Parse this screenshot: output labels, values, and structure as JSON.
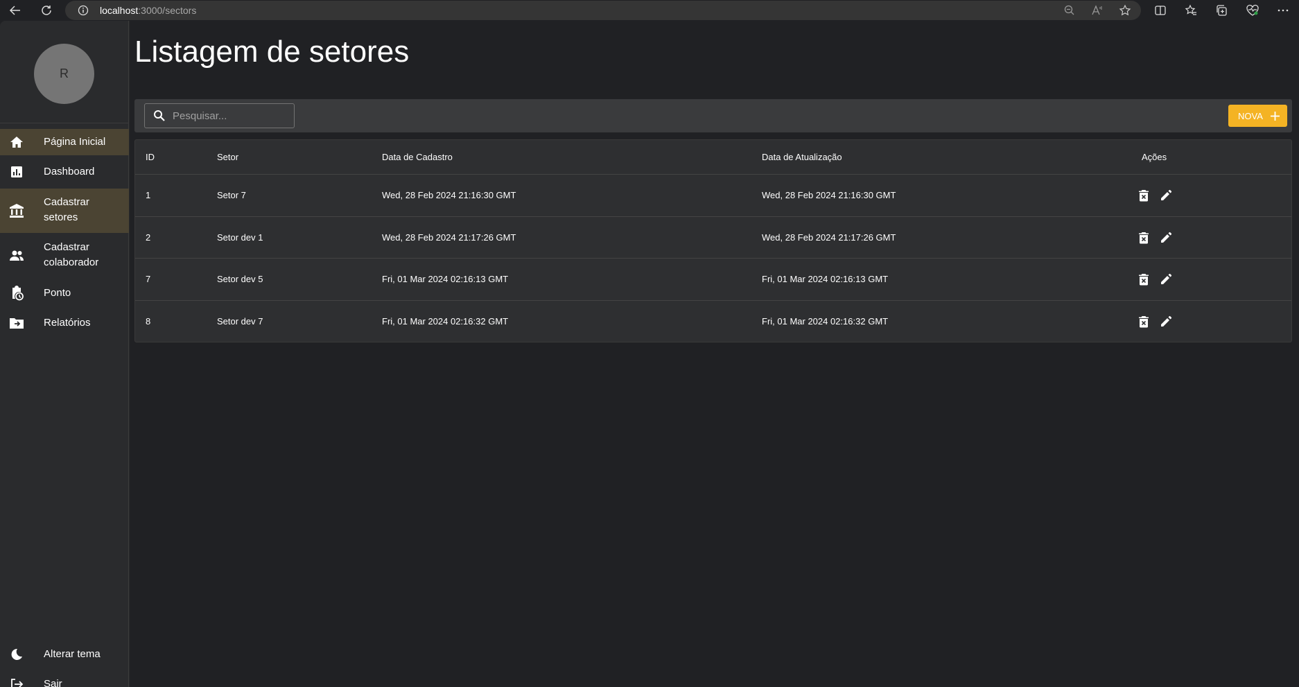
{
  "browser": {
    "url_host": "localhost",
    "url_path": ":3000/sectors"
  },
  "sidebar": {
    "avatar_initial": "R",
    "items": [
      {
        "label_lines": [
          "Página Inicial"
        ],
        "icon": "home-icon",
        "active": true
      },
      {
        "label_lines": [
          "Dashboard"
        ],
        "icon": "dashboard-icon",
        "active": false
      },
      {
        "label_lines": [
          "Cadastrar",
          "setores"
        ],
        "icon": "bank-icon",
        "active": true
      },
      {
        "label_lines": [
          "Cadastrar",
          "colaborador"
        ],
        "icon": "people-icon",
        "active": false
      },
      {
        "label_lines": [
          "Ponto"
        ],
        "icon": "clipboard-clock-icon",
        "active": false
      },
      {
        "label_lines": [
          "Relatórios"
        ],
        "icon": "folder-move-icon",
        "active": false
      }
    ],
    "bottom_items": [
      {
        "label": "Alterar tema",
        "icon": "moon-icon"
      },
      {
        "label": "Sair",
        "icon": "logout-icon"
      }
    ]
  },
  "main": {
    "title": "Listagem de setores",
    "search": {
      "placeholder": "Pesquisar...",
      "value": ""
    },
    "new_button_label": "NOVA",
    "table": {
      "headers": [
        "ID",
        "Setor",
        "Data de Cadastro",
        "Data de Atualização",
        "Ações"
      ],
      "rows": [
        {
          "id": "1",
          "setor": "Setor 7",
          "cadastro": "Wed, 28 Feb 2024 21:16:30 GMT",
          "atualizacao": "Wed, 28 Feb 2024 21:16:30 GMT"
        },
        {
          "id": "2",
          "setor": "Setor dev 1",
          "cadastro": "Wed, 28 Feb 2024 21:17:26 GMT",
          "atualizacao": "Wed, 28 Feb 2024 21:17:26 GMT"
        },
        {
          "id": "7",
          "setor": "Setor dev 5",
          "cadastro": "Fri, 01 Mar 2024 02:16:13 GMT",
          "atualizacao": "Fri, 01 Mar 2024 02:16:13 GMT"
        },
        {
          "id": "8",
          "setor": "Setor dev 7",
          "cadastro": "Fri, 01 Mar 2024 02:16:32 GMT",
          "atualizacao": "Fri, 01 Mar 2024 02:16:32 GMT"
        }
      ]
    }
  },
  "colors": {
    "accent": "#f4b324",
    "active_nav": "#4b4433",
    "background": "#202124"
  }
}
